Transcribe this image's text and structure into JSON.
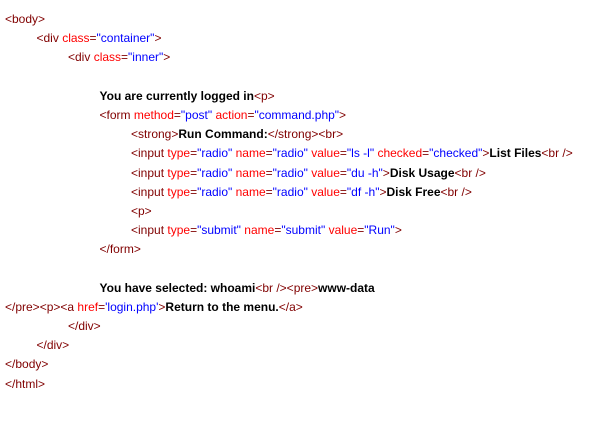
{
  "colors": {
    "tag": "#800000",
    "attr": "#ff0000",
    "value": "#0000ff",
    "text": "#000000",
    "background": "#ffffff"
  },
  "lines": [
    {
      "indent": 0,
      "segments": [
        {
          "t": "tag",
          "s": "<body>"
        }
      ]
    },
    {
      "indent": 1,
      "segments": [
        {
          "t": "tag",
          "s": "<div "
        },
        {
          "t": "attr",
          "s": "class"
        },
        {
          "t": "tag",
          "s": "="
        },
        {
          "t": "val",
          "s": "\"container\""
        },
        {
          "t": "tag",
          "s": ">"
        }
      ]
    },
    {
      "indent": 2,
      "segments": [
        {
          "t": "tag",
          "s": "<div "
        },
        {
          "t": "attr",
          "s": "class"
        },
        {
          "t": "tag",
          "s": "="
        },
        {
          "t": "val",
          "s": "\"inner\""
        },
        {
          "t": "tag",
          "s": ">"
        }
      ]
    },
    {
      "indent": 0,
      "segments": []
    },
    {
      "indent": 3,
      "segments": [
        {
          "t": "txt",
          "s": "You are currently logged in"
        },
        {
          "t": "tag",
          "s": "<p>"
        }
      ]
    },
    {
      "indent": 3,
      "segments": [
        {
          "t": "tag",
          "s": "<form "
        },
        {
          "t": "attr",
          "s": "method"
        },
        {
          "t": "tag",
          "s": "="
        },
        {
          "t": "val",
          "s": "\"post\""
        },
        {
          "t": "tag",
          "s": " "
        },
        {
          "t": "attr",
          "s": "action"
        },
        {
          "t": "tag",
          "s": "="
        },
        {
          "t": "val",
          "s": "\"command.php\""
        },
        {
          "t": "tag",
          "s": ">"
        }
      ]
    },
    {
      "indent": 4,
      "segments": [
        {
          "t": "tag",
          "s": "<strong>"
        },
        {
          "t": "txt",
          "s": "Run Command:"
        },
        {
          "t": "tag",
          "s": "</strong><br>"
        }
      ]
    },
    {
      "indent": 4,
      "segments": [
        {
          "t": "tag",
          "s": "<input "
        },
        {
          "t": "attr",
          "s": "type"
        },
        {
          "t": "tag",
          "s": "="
        },
        {
          "t": "val",
          "s": "\"radio\""
        },
        {
          "t": "tag",
          "s": " "
        },
        {
          "t": "attr",
          "s": "name"
        },
        {
          "t": "tag",
          "s": "="
        },
        {
          "t": "val",
          "s": "\"radio\""
        },
        {
          "t": "tag",
          "s": " "
        },
        {
          "t": "attr",
          "s": "value"
        },
        {
          "t": "tag",
          "s": "="
        },
        {
          "t": "val",
          "s": "\"ls -l\""
        },
        {
          "t": "tag",
          "s": " "
        },
        {
          "t": "attr",
          "s": "checked"
        },
        {
          "t": "tag",
          "s": "="
        },
        {
          "t": "val",
          "s": "\"checked\""
        },
        {
          "t": "tag",
          "s": ">"
        },
        {
          "t": "txt",
          "s": "List Files"
        },
        {
          "t": "tag",
          "s": "<br />"
        }
      ]
    },
    {
      "indent": 4,
      "segments": [
        {
          "t": "tag",
          "s": "<input "
        },
        {
          "t": "attr",
          "s": "type"
        },
        {
          "t": "tag",
          "s": "="
        },
        {
          "t": "val",
          "s": "\"radio\""
        },
        {
          "t": "tag",
          "s": " "
        },
        {
          "t": "attr",
          "s": "name"
        },
        {
          "t": "tag",
          "s": "="
        },
        {
          "t": "val",
          "s": "\"radio\""
        },
        {
          "t": "tag",
          "s": " "
        },
        {
          "t": "attr",
          "s": "value"
        },
        {
          "t": "tag",
          "s": "="
        },
        {
          "t": "val",
          "s": "\"du -h\""
        },
        {
          "t": "tag",
          "s": ">"
        },
        {
          "t": "txt",
          "s": "Disk Usage"
        },
        {
          "t": "tag",
          "s": "<br />"
        }
      ]
    },
    {
      "indent": 4,
      "segments": [
        {
          "t": "tag",
          "s": "<input "
        },
        {
          "t": "attr",
          "s": "type"
        },
        {
          "t": "tag",
          "s": "="
        },
        {
          "t": "val",
          "s": "\"radio\""
        },
        {
          "t": "tag",
          "s": " "
        },
        {
          "t": "attr",
          "s": "name"
        },
        {
          "t": "tag",
          "s": "="
        },
        {
          "t": "val",
          "s": "\"radio\""
        },
        {
          "t": "tag",
          "s": " "
        },
        {
          "t": "attr",
          "s": "value"
        },
        {
          "t": "tag",
          "s": "="
        },
        {
          "t": "val",
          "s": "\"df -h\""
        },
        {
          "t": "tag",
          "s": ">"
        },
        {
          "t": "txt",
          "s": "Disk Free"
        },
        {
          "t": "tag",
          "s": "<br />"
        }
      ]
    },
    {
      "indent": 4,
      "segments": [
        {
          "t": "tag",
          "s": "<p>"
        }
      ]
    },
    {
      "indent": 4,
      "segments": [
        {
          "t": "tag",
          "s": "<input "
        },
        {
          "t": "attr",
          "s": "type"
        },
        {
          "t": "tag",
          "s": "="
        },
        {
          "t": "val",
          "s": "\"submit\""
        },
        {
          "t": "tag",
          "s": " "
        },
        {
          "t": "attr",
          "s": "name"
        },
        {
          "t": "tag",
          "s": "="
        },
        {
          "t": "val",
          "s": "\"submit\""
        },
        {
          "t": "tag",
          "s": " "
        },
        {
          "t": "attr",
          "s": "value"
        },
        {
          "t": "tag",
          "s": "="
        },
        {
          "t": "val",
          "s": "\"Run\""
        },
        {
          "t": "tag",
          "s": ">"
        }
      ]
    },
    {
      "indent": 3,
      "segments": [
        {
          "t": "tag",
          "s": "</form>"
        }
      ]
    },
    {
      "indent": 0,
      "segments": []
    },
    {
      "indent": 3,
      "segments": [
        {
          "t": "txt",
          "s": "You have selected: whoami"
        },
        {
          "t": "tag",
          "s": "<br /><pre>"
        },
        {
          "t": "txt",
          "s": "www-data"
        }
      ]
    },
    {
      "indent": 0,
      "segments": [
        {
          "t": "tag",
          "s": "</pre><p><a "
        },
        {
          "t": "attr",
          "s": "href"
        },
        {
          "t": "tag",
          "s": "="
        },
        {
          "t": "val",
          "s": "'login.php'"
        },
        {
          "t": "tag",
          "s": ">"
        },
        {
          "t": "txt",
          "s": "Return to the menu."
        },
        {
          "t": "tag",
          "s": "</a>"
        }
      ]
    },
    {
      "indent": 2,
      "segments": [
        {
          "t": "tag",
          "s": "</div>"
        }
      ]
    },
    {
      "indent": 1,
      "segments": [
        {
          "t": "tag",
          "s": "</div>"
        }
      ]
    },
    {
      "indent": 0,
      "segments": [
        {
          "t": "tag",
          "s": "</body>"
        }
      ]
    },
    {
      "indent": 0,
      "segments": [
        {
          "t": "tag",
          "s": "</html>"
        }
      ]
    }
  ]
}
